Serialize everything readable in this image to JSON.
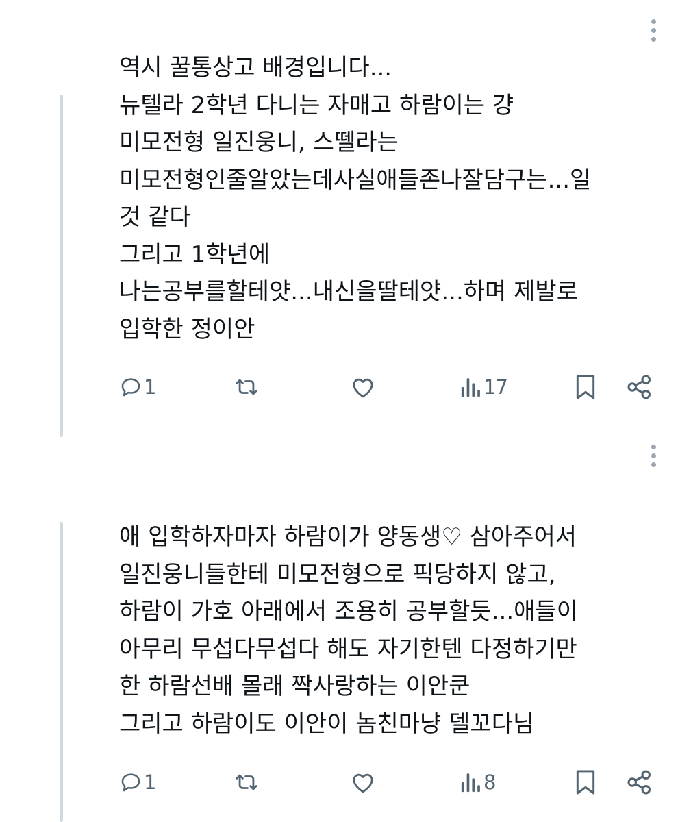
{
  "tweets": [
    {
      "lines": [
        "역시 꿀통상고 배경입니다...",
        "뉴텔라 2학년 다니는 자매고 하람이는 걍",
        "미모전형 일진웅니, 스뗄라는",
        "미모전형인줄알았는데사실애들존나잘담구는...일",
        "것 같다",
        "그리고 1학년에",
        "나는공부를할테얏...내신을딸테얏...하며 제발로",
        "입학한 정이안"
      ],
      "actions": {
        "replies": "1",
        "reposts": "",
        "likes": "",
        "views": "17"
      }
    },
    {
      "lines": [
        "애 입학하자마자 하람이가 양동생♡ 삼아주어서",
        "일진웅니들한테 미모전형으로 픽당하지 않고,",
        "하람이 가호 아래에서 조용히 공부할듯...애들이",
        "아무리 무섭다무섭다 해도 자기한텐 다정하기만",
        "한 하람선배 몰래 짝사랑하는 이안쿤",
        "그리고 하람이도 이안이 놈친마냥 델꼬다님"
      ],
      "actions": {
        "replies": "1",
        "reposts": "",
        "likes": "",
        "views": "8"
      }
    }
  ],
  "colors": {
    "text": "#0f1419",
    "icon": "#536471",
    "thread_line": "#cfd9de",
    "more_dots": "#9aa5ad"
  },
  "icons": [
    "more-vertical-icon",
    "reply-icon",
    "repost-icon",
    "like-icon",
    "views-icon",
    "bookmark-icon",
    "share-icon"
  ]
}
